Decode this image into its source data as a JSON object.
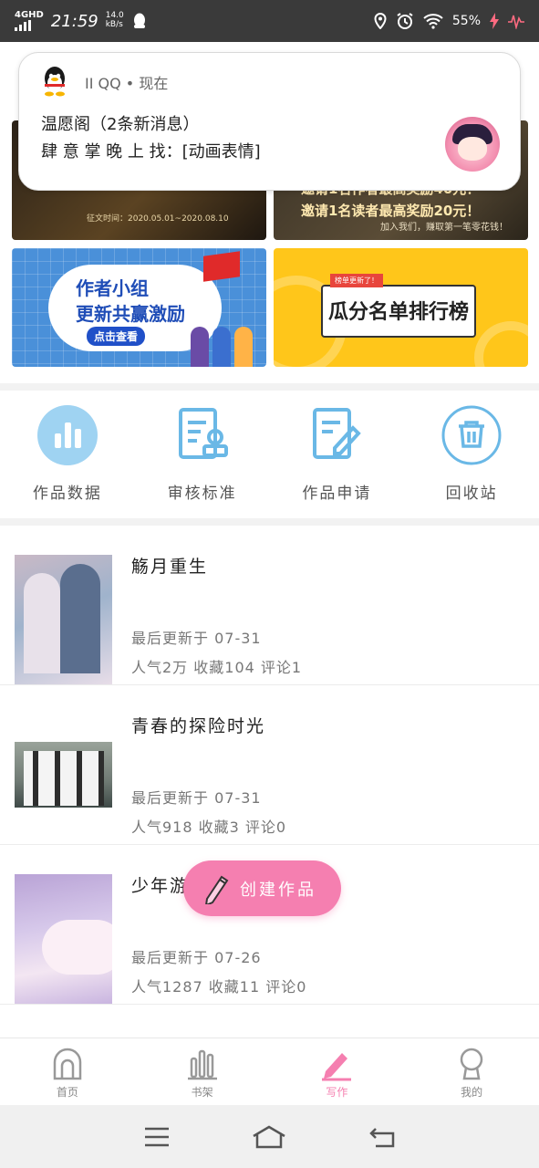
{
  "status_bar": {
    "network": "4GHD",
    "time": "21:59",
    "speed_value": "14.0",
    "speed_unit": "kB/s",
    "battery": "55%",
    "icons": [
      "location-icon",
      "alarm-icon",
      "wifi-icon",
      "charging-icon",
      "pulse-icon"
    ]
  },
  "notification": {
    "app_line": "II QQ • 现在",
    "line1": "温愿阁（2条新消息）",
    "line2": "肆 意 掌 晚 上 找：[动画表情]"
  },
  "banners": {
    "b1_tag": "征文时间：2020.05.01~2020.08.10",
    "b2_line1": "邀请1名作者最高奖励40元！",
    "b2_line2": "邀请1名读者最高奖励20元！",
    "b2_line3": "加入我们，赚取第一笔零花钱！",
    "b3_title1": "作者小组",
    "b3_title2": "更新共赢激励",
    "b3_button": "点击查看",
    "b4_ribbon": "榜单更新了！",
    "b4_title": "瓜分名单排行榜"
  },
  "functions": [
    {
      "label": "作品数据",
      "icon": "bar-chart-icon"
    },
    {
      "label": "审核标准",
      "icon": "document-review-icon"
    },
    {
      "label": "作品申请",
      "icon": "edit-document-icon"
    },
    {
      "label": "回收站",
      "icon": "trash-icon"
    }
  ],
  "works": [
    {
      "title": "觞月重生",
      "updated": "最后更新于 07-31",
      "stats": "人气2万 收藏104 评论1"
    },
    {
      "title": "青春的探险时光",
      "updated": "最后更新于 07-31",
      "stats": "人气918 收藏3 评论0"
    },
    {
      "title": "少年游",
      "updated": "最后更新于 07-26",
      "stats": "人气1287 收藏11 评论0"
    }
  ],
  "fab": {
    "label": "创建作品",
    "icon": "pencil-icon"
  },
  "tabs": [
    {
      "label": "首页",
      "icon": "home-arch-icon",
      "active": false
    },
    {
      "label": "书架",
      "icon": "bookshelf-icon",
      "active": false
    },
    {
      "label": "写作",
      "icon": "pen-icon",
      "active": true
    },
    {
      "label": "我的",
      "icon": "profile-icon",
      "active": false
    }
  ],
  "colors": {
    "accent": "#f57fb0",
    "icon_blue": "#6ab8e6",
    "func_icon_bg": "#9fd3f2"
  }
}
